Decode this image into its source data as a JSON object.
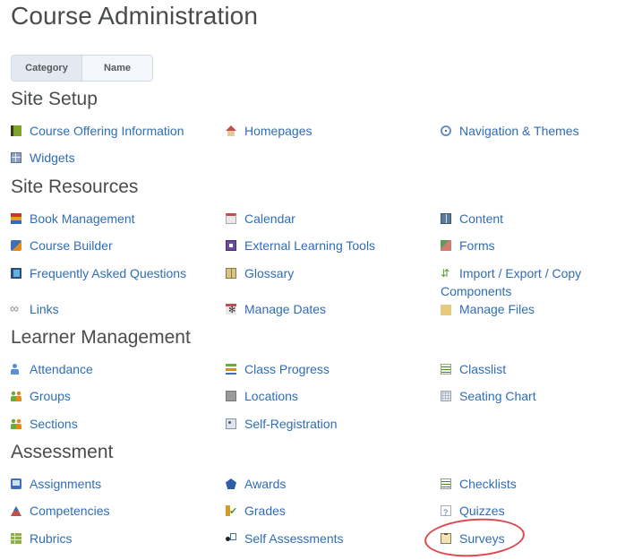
{
  "page": {
    "title": "Course Administration",
    "view_toggle": {
      "options": [
        "Category",
        "Name"
      ],
      "selected": "Category"
    },
    "annotation": {
      "type": "red-ellipse-highlight",
      "target": "Surveys",
      "color": "#e0474c"
    },
    "link_color": "#2f6db5",
    "sections": [
      {
        "title": "Site Setup",
        "items": [
          {
            "label": "Course Offering Information",
            "icon": "book-icon"
          },
          {
            "label": "Homepages",
            "icon": "home-icon"
          },
          {
            "label": "Navigation & Themes",
            "icon": "compass-icon"
          },
          {
            "label": "Widgets",
            "icon": "widgets-icon"
          }
        ]
      },
      {
        "title": "Site Resources",
        "items": [
          {
            "label": "Book Management",
            "icon": "book-stack-icon"
          },
          {
            "label": "Calendar",
            "icon": "calendar-icon"
          },
          {
            "label": "Content",
            "icon": "content-icon"
          },
          {
            "label": "Course Builder",
            "icon": "course-builder-icon"
          },
          {
            "label": "External Learning Tools",
            "icon": "external-tools-icon"
          },
          {
            "label": "Forms",
            "icon": "forms-icon"
          },
          {
            "label": "Frequently Asked Questions",
            "icon": "faq-icon"
          },
          {
            "label": "Glossary",
            "icon": "glossary-icon"
          },
          {
            "label": "Import / Export / Copy Components",
            "icon": "import-export-icon"
          },
          {
            "label": "Links",
            "icon": "link-icon"
          },
          {
            "label": "Manage Dates",
            "icon": "manage-dates-icon"
          },
          {
            "label": "Manage Files",
            "icon": "folder-icon"
          }
        ]
      },
      {
        "title": "Learner Management",
        "items": [
          {
            "label": "Attendance",
            "icon": "attendance-icon"
          },
          {
            "label": "Class Progress",
            "icon": "class-progress-icon"
          },
          {
            "label": "Classlist",
            "icon": "classlist-icon"
          },
          {
            "label": "Groups",
            "icon": "groups-icon"
          },
          {
            "label": "Locations",
            "icon": "locations-icon"
          },
          {
            "label": "Seating Chart",
            "icon": "seating-chart-icon"
          },
          {
            "label": "Sections",
            "icon": "sections-icon"
          },
          {
            "label": "Self-Registration",
            "icon": "self-registration-icon"
          }
        ]
      },
      {
        "title": "Assessment",
        "items": [
          {
            "label": "Assignments",
            "icon": "assignments-icon"
          },
          {
            "label": "Awards",
            "icon": "awards-icon"
          },
          {
            "label": "Checklists",
            "icon": "checklists-icon"
          },
          {
            "label": "Competencies",
            "icon": "competencies-icon"
          },
          {
            "label": "Grades",
            "icon": "grades-icon"
          },
          {
            "label": "Quizzes",
            "icon": "quizzes-icon"
          },
          {
            "label": "Rubrics",
            "icon": "rubrics-icon"
          },
          {
            "label": "Self Assessments",
            "icon": "self-assessments-icon"
          },
          {
            "label": "Surveys",
            "icon": "surveys-icon"
          }
        ]
      }
    ]
  }
}
